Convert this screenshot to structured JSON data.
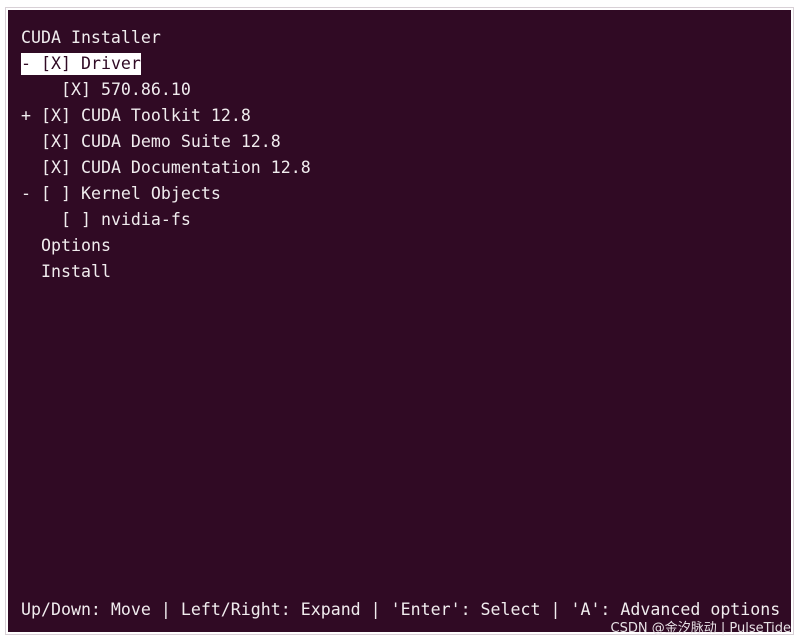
{
  "window": {
    "title": "CUDA Installer"
  },
  "menu": {
    "items": [
      {
        "expander": "- ",
        "checkbox": "[X]",
        "label": "Driver"
      },
      {
        "expander": "    ",
        "checkbox": "[X]",
        "label": "570.86.10"
      },
      {
        "expander": "+ ",
        "checkbox": "[X]",
        "label": "CUDA Toolkit 12.8"
      },
      {
        "expander": "  ",
        "checkbox": "[X]",
        "label": "CUDA Demo Suite 12.8"
      },
      {
        "expander": "  ",
        "checkbox": "[X]",
        "label": "CUDA Documentation 12.8"
      },
      {
        "expander": "- ",
        "checkbox": "[ ]",
        "label": "Kernel Objects"
      },
      {
        "expander": "    ",
        "checkbox": "[ ]",
        "label": "nvidia-fs"
      }
    ],
    "selected_index": 0,
    "options_label": "Options",
    "install_label": "Install"
  },
  "footer": {
    "help_text": "Up/Down: Move | Left/Right: Expand | 'Enter': Select | 'A': Advanced options"
  },
  "watermark": {
    "text": "CSDN @金汐脉动 | PulseTide"
  },
  "colors": {
    "terminal_background": "#300a24",
    "terminal_foreground": "#f0ecee",
    "highlight_background": "#ffffff"
  }
}
